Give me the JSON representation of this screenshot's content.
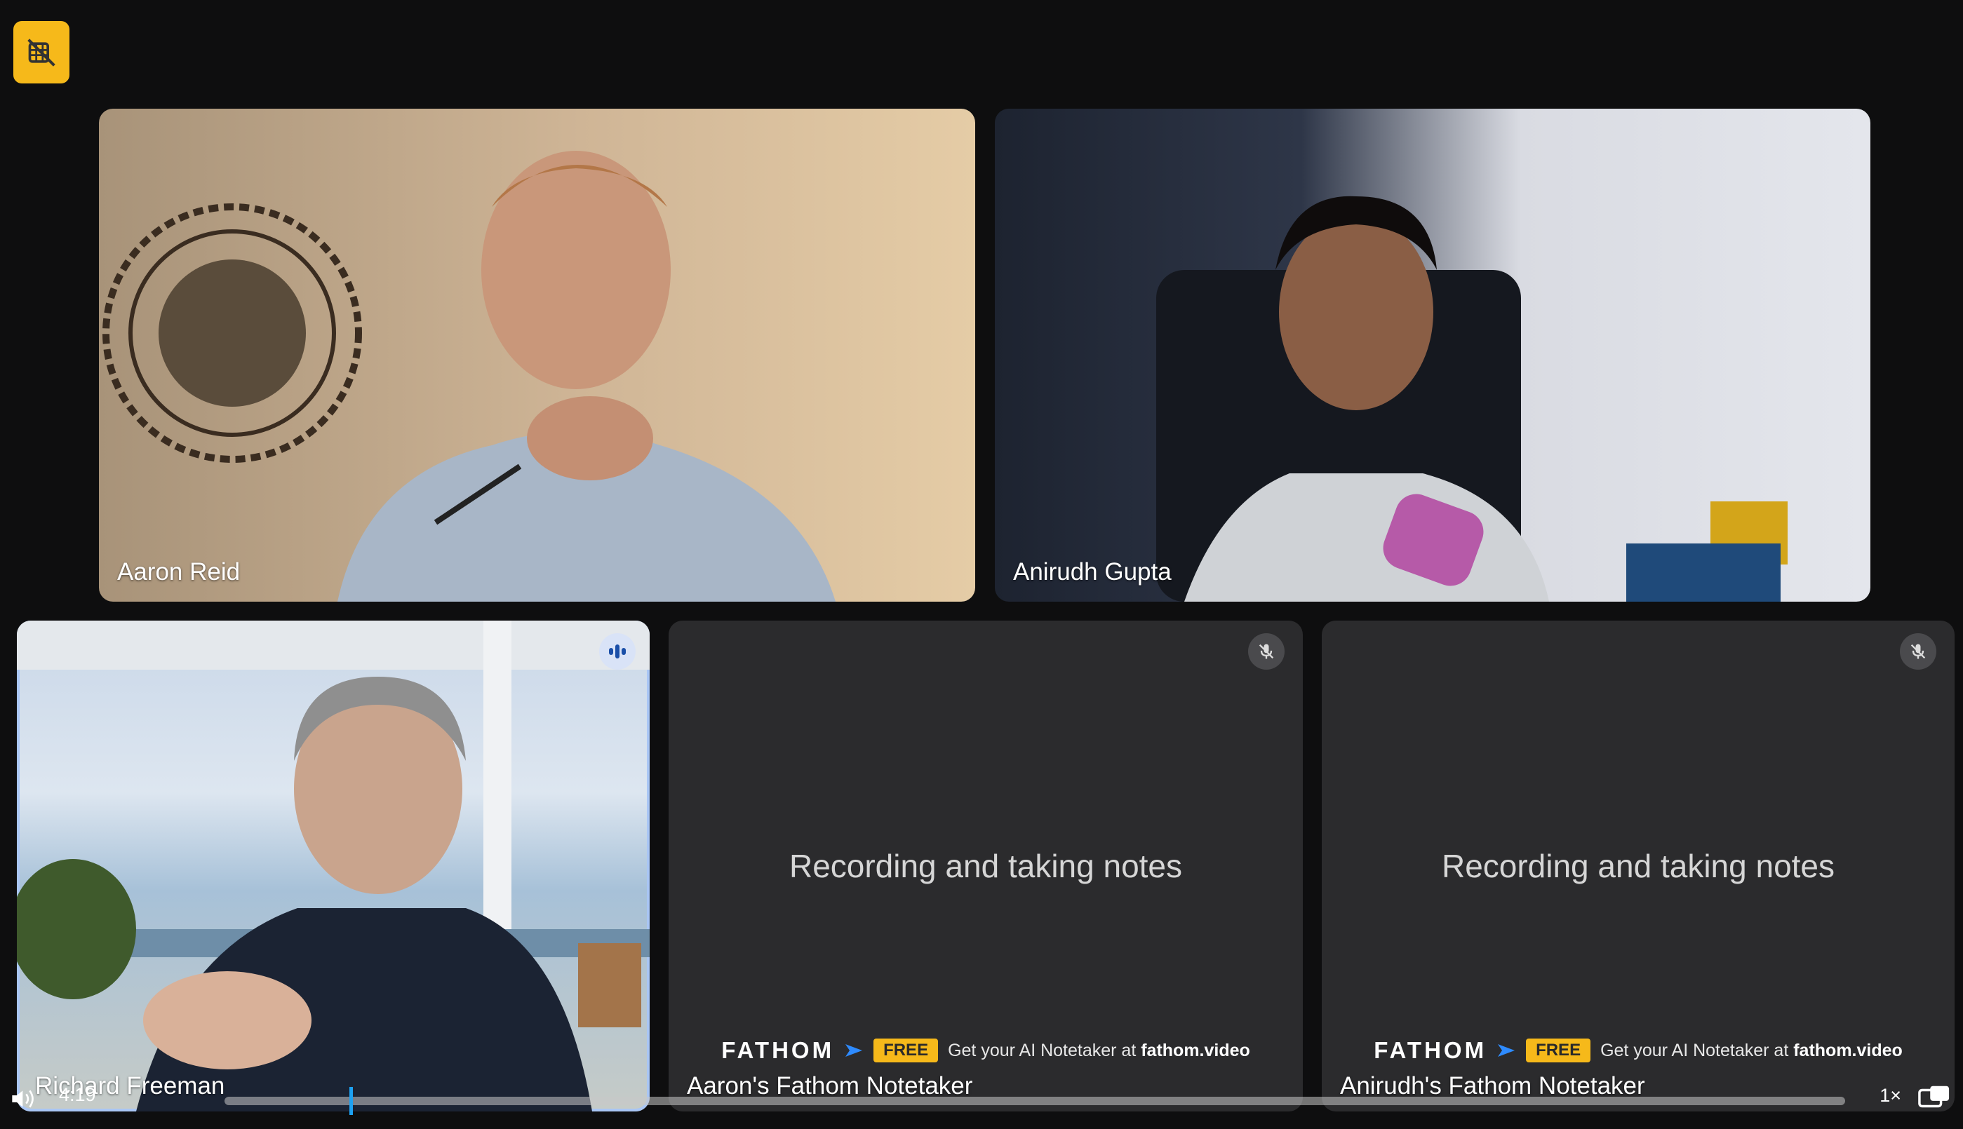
{
  "top_button": {
    "icon": "video-off-icon",
    "color": "#f6b91a"
  },
  "tiles": [
    {
      "name": "Aaron Reid"
    },
    {
      "name": "Anirudh Gupta"
    },
    {
      "name": "Richard Freeman",
      "speaking": true
    },
    {
      "name": "Aaron's Fathom Notetaker",
      "status": "Recording and taking notes",
      "muted": true
    },
    {
      "name": "Anirudh's Fathom Notetaker",
      "status": "Recording and taking notes",
      "muted": true
    }
  ],
  "fathom": {
    "logo": "FATHOM",
    "badge": "FREE",
    "cta_prefix": "Get your AI Notetaker at",
    "cta_link": "fathom.video"
  },
  "player": {
    "time": "4:19",
    "speed": "1×"
  }
}
